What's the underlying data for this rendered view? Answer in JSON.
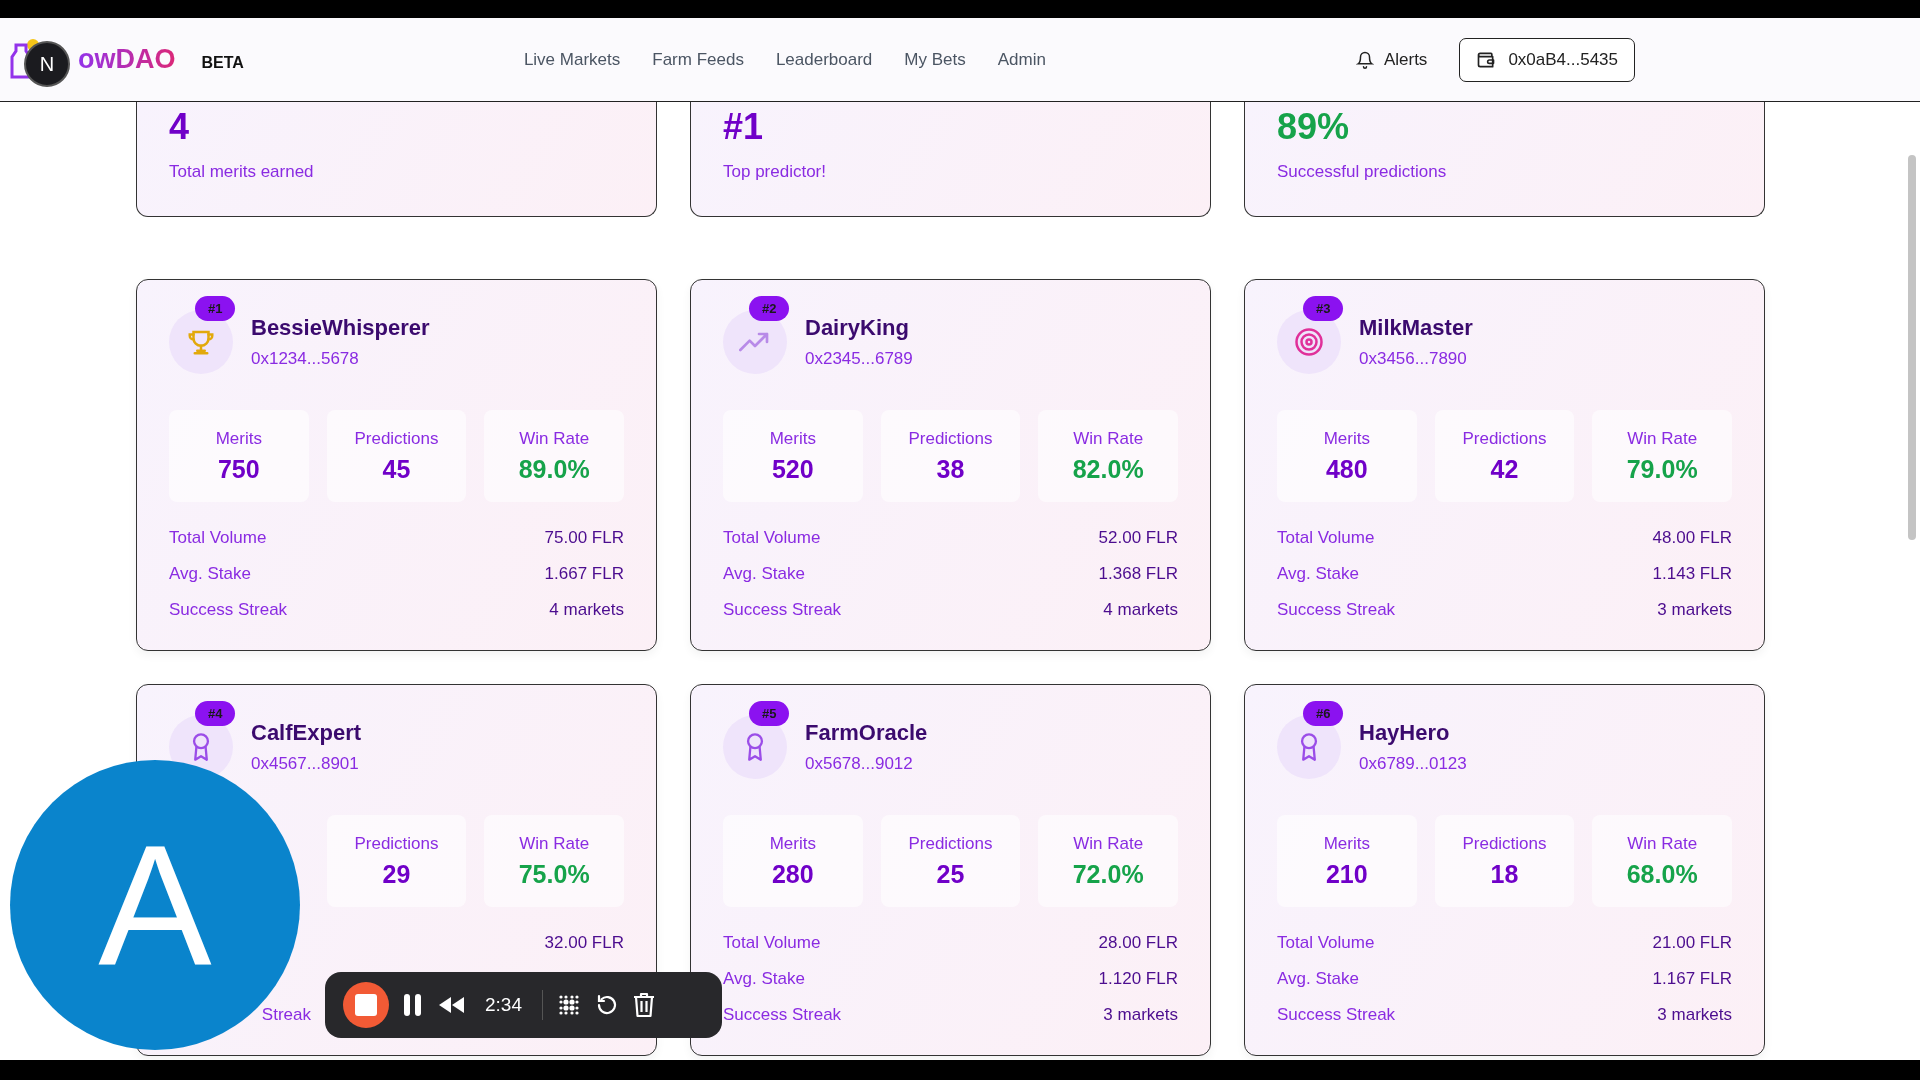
{
  "header": {
    "logo_text": "owDAO",
    "badge": "BETA",
    "nav": [
      {
        "label": "Live Markets"
      },
      {
        "label": "Farm Feeds"
      },
      {
        "label": "Leaderboard"
      },
      {
        "label": "My Bets"
      },
      {
        "label": "Admin"
      }
    ],
    "alerts": "Alerts",
    "wallet": "0x0aB4...5435"
  },
  "summary": [
    {
      "value": "4",
      "caption": "Total merits earned",
      "kind": "purple"
    },
    {
      "value": "#1",
      "caption": "Top predictor!",
      "kind": "purple"
    },
    {
      "value": "89%",
      "caption": "Successful predictions",
      "kind": "green"
    }
  ],
  "predictors": [
    {
      "rank": "#1",
      "name": "BessieWhisperer",
      "address": "0x1234...5678",
      "stats": [
        {
          "label": "Merits",
          "value": "750"
        },
        {
          "label": "Predictions",
          "value": "45"
        },
        {
          "label": "Win Rate",
          "value": "89.0%"
        }
      ],
      "details": [
        {
          "label": "Total Volume",
          "value": "75.00 FLR"
        },
        {
          "label": "Avg. Stake",
          "value": "1.667 FLR"
        },
        {
          "label": "Success Streak",
          "value": "4 markets"
        }
      ]
    },
    {
      "rank": "#2",
      "name": "DairyKing",
      "address": "0x2345...6789",
      "stats": [
        {
          "label": "Merits",
          "value": "520"
        },
        {
          "label": "Predictions",
          "value": "38"
        },
        {
          "label": "Win Rate",
          "value": "82.0%"
        }
      ],
      "details": [
        {
          "label": "Total Volume",
          "value": "52.00 FLR"
        },
        {
          "label": "Avg. Stake",
          "value": "1.368 FLR"
        },
        {
          "label": "Success Streak",
          "value": "4 markets"
        }
      ]
    },
    {
      "rank": "#3",
      "name": "MilkMaster",
      "address": "0x3456...7890",
      "stats": [
        {
          "label": "Merits",
          "value": "480"
        },
        {
          "label": "Predictions",
          "value": "42"
        },
        {
          "label": "Win Rate",
          "value": "79.0%"
        }
      ],
      "details": [
        {
          "label": "Total Volume",
          "value": "48.00 FLR"
        },
        {
          "label": "Avg. Stake",
          "value": "1.143 FLR"
        },
        {
          "label": "Success Streak",
          "value": "3 markets"
        }
      ]
    },
    {
      "rank": "#4",
      "name": "CalfExpert",
      "address": "0x4567...8901",
      "stats": [
        {
          "kind": "hidden"
        },
        {
          "label": "Predictions",
          "value": "29"
        },
        {
          "label": "Win Rate",
          "value": "75.0%"
        }
      ],
      "details": [
        {
          "value": "32.00 FLR"
        },
        {
          "kind": "hidden"
        },
        {
          "label": "Streak",
          "kind": "tail"
        }
      ]
    },
    {
      "rank": "#5",
      "name": "FarmOracle",
      "address": "0x5678...9012",
      "stats": [
        {
          "label": "Merits",
          "value": "280"
        },
        {
          "label": "Predictions",
          "value": "25"
        },
        {
          "label": "Win Rate",
          "value": "72.0%"
        }
      ],
      "details": [
        {
          "label": "Total Volume",
          "value": "28.00 FLR"
        },
        {
          "label": "Avg. Stake",
          "value": "1.120 FLR"
        },
        {
          "label": "Success Streak",
          "value": "3 markets"
        }
      ]
    },
    {
      "rank": "#6",
      "name": "HayHero",
      "address": "0x6789...0123",
      "stats": [
        {
          "label": "Merits",
          "value": "210"
        },
        {
          "label": "Predictions",
          "value": "18"
        },
        {
          "label": "Win Rate",
          "value": "68.0%"
        }
      ],
      "details": [
        {
          "label": "Total Volume",
          "value": "21.00 FLR"
        },
        {
          "label": "Avg. Stake",
          "value": "1.167 FLR"
        },
        {
          "label": "Success Streak",
          "value": "3 markets"
        }
      ]
    }
  ],
  "dev_indicator": "N",
  "avatar": "A",
  "recorder": {
    "time": "2:34"
  }
}
